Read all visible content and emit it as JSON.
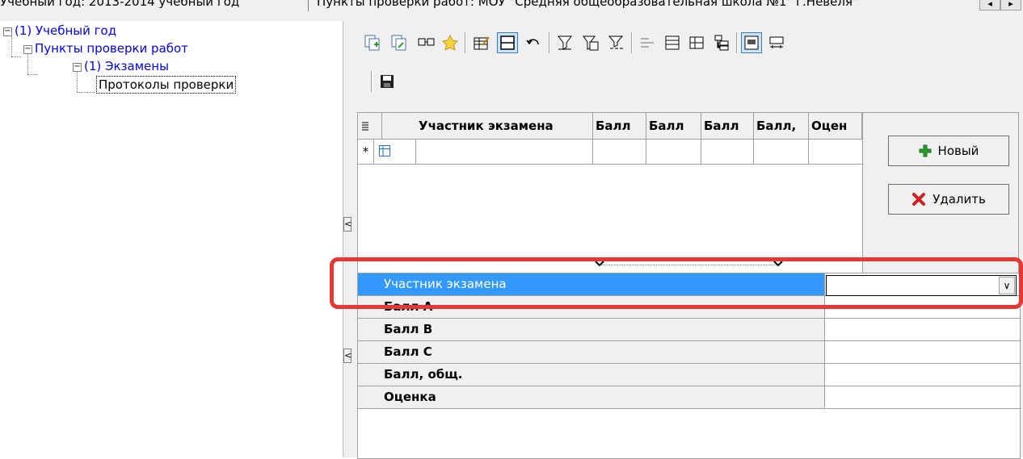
{
  "topbar": {
    "crumb_year": "Учебный год: 2013-2014 учебный год",
    "crumb_points": "Пункты проверки работ: МОУ \"Средняя общеобразовательная школа №1\" г.Невеля\"",
    "nav_left": "◂",
    "nav_right": "▸"
  },
  "tree": {
    "items": [
      {
        "label": "(1) Учебный год",
        "expander": "−"
      },
      {
        "label": "Пункты проверки работ",
        "expander": "−"
      },
      {
        "label": "(1) Экзамены",
        "expander": "−"
      },
      {
        "label": "Протоколы проверки"
      }
    ]
  },
  "splitter": {
    "arrow": "<"
  },
  "toolbar": {
    "icons": [
      "copy-add-icon",
      "copy-edit-icon",
      "link-icon",
      "star-icon",
      "edit-record-icon",
      "grid-view-icon",
      "undo-icon",
      "filter-icon",
      "filter-settings-icon",
      "filter-clear-icon",
      "align-icon",
      "list-view-icon",
      "split-view-icon",
      "tree-view-icon",
      "form-view-icon",
      "columns-icon",
      "save-icon"
    ]
  },
  "grid": {
    "columns": [
      "Участник экзамена",
      "Балл",
      "Балл",
      "Балл",
      "Балл,",
      "Оцен"
    ],
    "new_row_marker": "*"
  },
  "buttons": {
    "new_label": "Новый",
    "delete_label": "Удалить"
  },
  "props": {
    "rows": [
      {
        "label": "Участник экзамена",
        "value": ""
      },
      {
        "label": "Балл A",
        "value": ""
      },
      {
        "label": "Балл B",
        "value": ""
      },
      {
        "label": "Балл C",
        "value": ""
      },
      {
        "label": "Балл, общ.",
        "value": ""
      },
      {
        "label": "Оценка",
        "value": ""
      }
    ],
    "dropdown_arrow": "∨"
  },
  "colors": {
    "selection": "#3399ff",
    "highlight": "#e53935",
    "tree_link": "#0000ee"
  }
}
